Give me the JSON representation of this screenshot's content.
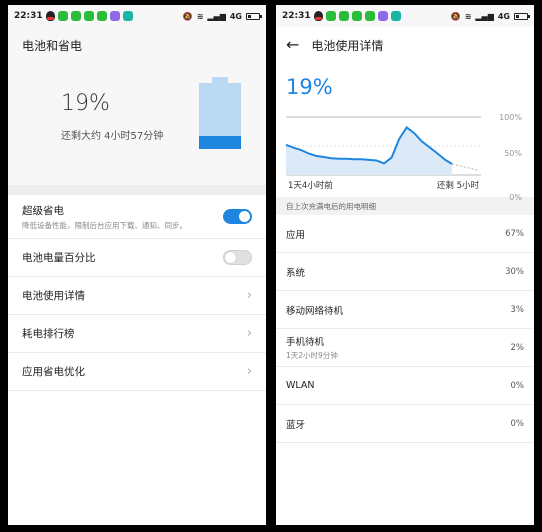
{
  "status": {
    "time": "22:31",
    "network": "4G"
  },
  "left": {
    "title": "电池和省电",
    "percent": "19%",
    "remaining": "还剩大约 4小时57分钟",
    "battery_level": 0.19,
    "super_saver": {
      "label": "超级省电",
      "sub": "降低设备性能，限制后台应用下载、通知、同步。",
      "on": true
    },
    "percentage_toggle": {
      "label": "电池电量百分比",
      "on": false
    },
    "items": [
      "电池使用详情",
      "耗电排行榜",
      "应用省电优化"
    ]
  },
  "right": {
    "title": "电池使用详情",
    "percent": "19%",
    "chart_data": {
      "type": "area",
      "y_ticks": [
        "100%",
        "50%",
        "0%"
      ],
      "ylim": [
        0,
        100
      ],
      "x_start_label": "1天4小时前",
      "x_end_label": "还剩 5小时",
      "values": [
        52,
        47,
        43,
        37,
        33,
        31,
        29,
        28,
        28,
        27,
        27,
        26,
        25,
        20,
        30,
        62,
        82,
        72,
        58,
        48,
        38,
        27,
        19
      ],
      "projection": [
        19,
        8
      ],
      "color": "#1f86e0"
    },
    "section_header": "自上次充满电后的用电明细",
    "usage": [
      {
        "name": "应用",
        "value": "67%"
      },
      {
        "name": "系统",
        "value": "30%"
      },
      {
        "name": "移动网络待机",
        "value": "3%"
      },
      {
        "name": "手机待机",
        "sub": "1天2小时9分钟",
        "value": "2%"
      },
      {
        "name": "WLAN",
        "value": "0%"
      },
      {
        "name": "蓝牙",
        "value": "0%"
      }
    ]
  }
}
